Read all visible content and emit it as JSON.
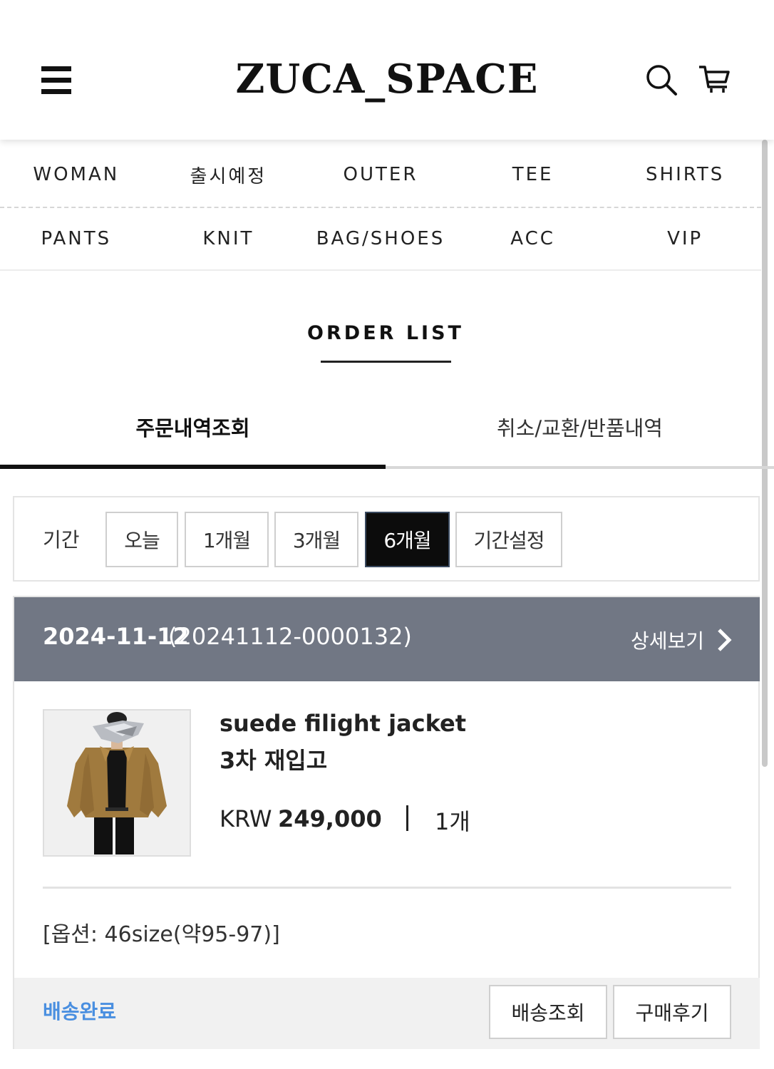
{
  "header": {
    "logo": "ZUCA_SPACE",
    "menu_icon": "hamburger-menu-icon",
    "search_icon": "search-icon",
    "cart_icon": "cart-icon"
  },
  "nav": {
    "row1": [
      "WOMAN",
      "출시예정",
      "OUTER",
      "TEE",
      "SHIRTS"
    ],
    "row2": [
      "PANTS",
      "KNIT",
      "BAG/SHOES",
      "ACC",
      "VIP"
    ]
  },
  "page": {
    "title": "ORDER LIST"
  },
  "tabs": [
    {
      "label": "주문내역조회",
      "active": true
    },
    {
      "label": "취소/교환/반품내역",
      "active": false
    }
  ],
  "period": {
    "label": "기간",
    "options": [
      "오늘",
      "1개월",
      "3개월",
      "6개월",
      "기간설정"
    ],
    "selected": "6개월"
  },
  "order": {
    "date": "2024-11-12",
    "order_no": "(20241112-0000132)",
    "detail_label": "상세보기",
    "product": {
      "name_line1": "suede filight jacket",
      "name_line2": "3차 재입고",
      "currency": "KRW",
      "price": "249,000",
      "qty": "1개",
      "option": "[옵션: 46size(약95-97)]"
    },
    "status": "배송완료",
    "track_label": "배송조회",
    "review_label": "구매후기"
  },
  "colors": {
    "order_header_bg": "#717784",
    "status_blue": "#4a8fe0",
    "active_button_bg": "#0c0c0c"
  }
}
